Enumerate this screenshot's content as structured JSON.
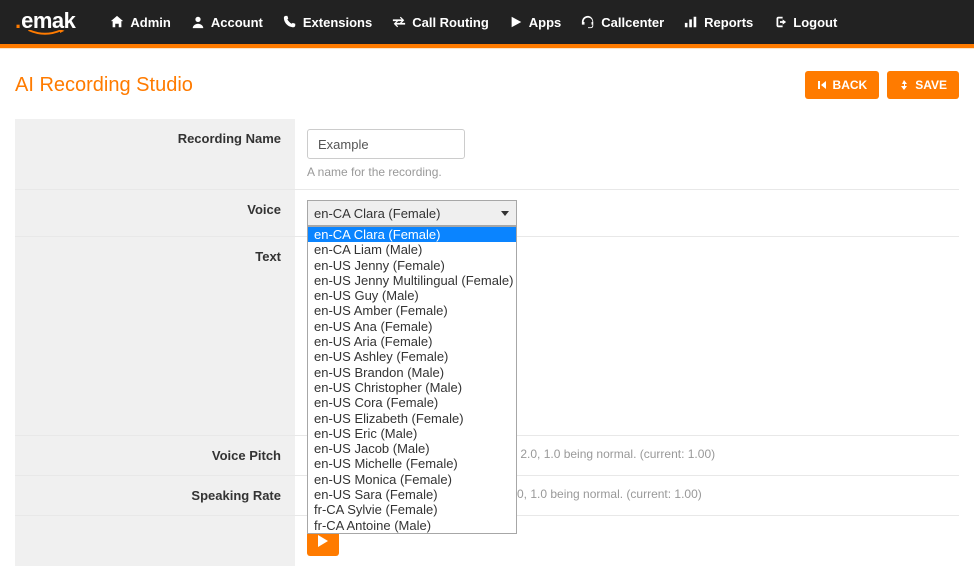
{
  "brand": {
    "prefix": ".",
    "name": "emak"
  },
  "nav": [
    {
      "icon": "home",
      "label": "Admin"
    },
    {
      "icon": "user",
      "label": "Account"
    },
    {
      "icon": "phone",
      "label": "Extensions"
    },
    {
      "icon": "swap",
      "label": "Call Routing"
    },
    {
      "icon": "play",
      "label": "Apps"
    },
    {
      "icon": "headset",
      "label": "Callcenter"
    },
    {
      "icon": "chart",
      "label": "Reports"
    },
    {
      "icon": "signout",
      "label": "Logout"
    }
  ],
  "page_title": "AI Recording Studio",
  "buttons": {
    "back": "BACK",
    "save": "SAVE"
  },
  "form": {
    "recording_name": {
      "label": "Recording Name",
      "value": "Example",
      "help": "A name for the recording."
    },
    "voice": {
      "label": "Voice",
      "selected": "en-CA Clara (Female)"
    },
    "text": {
      "label": "Text",
      "value": ""
    },
    "voice_pitch": {
      "label": "Voice Pitch",
      "help_suffix": " to 2.0, 1.0 being normal. (current: 1.00)"
    },
    "speaking_rate": {
      "label": "Speaking Rate",
      "help_suffix": "3.0, 1.0 being normal. (current: 1.00)"
    }
  },
  "voice_options": [
    "en-CA Clara (Female)",
    "en-CA Liam (Male)",
    "en-US Jenny (Female)",
    "en-US Jenny Multilingual (Female)",
    "en-US Guy (Male)",
    "en-US Amber (Female)",
    "en-US Ana (Female)",
    "en-US Aria (Female)",
    "en-US Ashley (Female)",
    "en-US Brandon (Male)",
    "en-US Christopher (Male)",
    "en-US Cora (Female)",
    "en-US Elizabeth (Female)",
    "en-US Eric (Male)",
    "en-US Jacob (Male)",
    "en-US Michelle (Female)",
    "en-US Monica (Female)",
    "en-US Sara (Female)",
    "fr-CA Sylvie (Female)",
    "fr-CA Antoine (Male)"
  ]
}
